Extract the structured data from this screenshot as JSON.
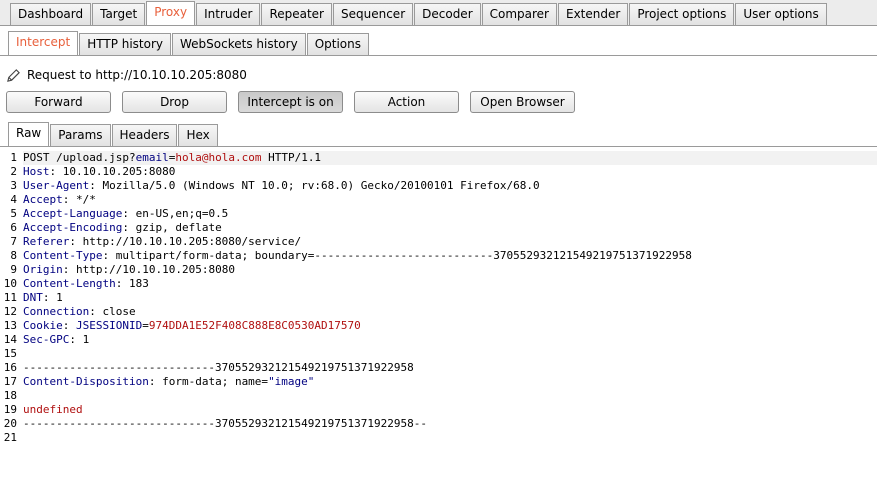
{
  "main_tabs": [
    "Dashboard",
    "Target",
    "Proxy",
    "Intruder",
    "Repeater",
    "Sequencer",
    "Decoder",
    "Comparer",
    "Extender",
    "Project options",
    "User options"
  ],
  "sub_tabs": [
    "Intercept",
    "HTTP history",
    "WebSockets history",
    "Options"
  ],
  "request_label": "Request to http://10.10.10.205:8080",
  "buttons": {
    "forward": "Forward",
    "drop": "Drop",
    "intercept": "Intercept is on",
    "action": "Action",
    "open_browser": "Open Browser"
  },
  "editor_tabs": [
    "Raw",
    "Params",
    "Headers",
    "Hex"
  ],
  "request": {
    "method": "POST",
    "path": "/upload.jsp?",
    "param_name": "email",
    "param_value": "hola@hola.com",
    "protocol": "HTTP/1.1",
    "headers": [
      {
        "name": "Host",
        "value": "10.10.10.205:8080"
      },
      {
        "name": "User-Agent",
        "value": "Mozilla/5.0 (Windows NT 10.0; rv:68.0) Gecko/20100101 Firefox/68.0"
      },
      {
        "name": "Accept",
        "value": "*/*"
      },
      {
        "name": "Accept-Language",
        "value": "en-US,en;q=0.5"
      },
      {
        "name": "Accept-Encoding",
        "value": "gzip, deflate"
      },
      {
        "name": "Referer",
        "value": "http://10.10.10.205:8080/service/"
      },
      {
        "name": "Content-Type",
        "value": "multipart/form-data; boundary=---------------------------370552932121549219751371922958"
      },
      {
        "name": "Origin",
        "value": "http://10.10.10.205:8080"
      },
      {
        "name": "Content-Length",
        "value": "183"
      },
      {
        "name": "DNT",
        "value": "1"
      },
      {
        "name": "Connection",
        "value": "close"
      }
    ],
    "cookie_name": "JSESSIONID",
    "cookie_value": "974DDA1E52F408C888E8C0530AD17570",
    "sec_gpc": "1",
    "boundary_line": "-----------------------------370552932121549219751371922958",
    "content_disposition_prefix": "form-data; name=",
    "content_disposition_name": "\"image\"",
    "body_value": "undefined",
    "boundary_end": "-----------------------------370552932121549219751371922958--"
  },
  "colors": {
    "active_tab": "#e8603c",
    "header_key": "#000080",
    "highlight": "#b01010"
  }
}
